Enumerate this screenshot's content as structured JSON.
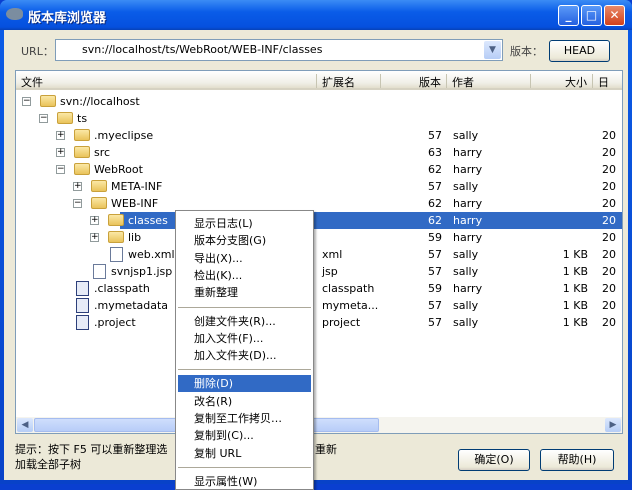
{
  "window": {
    "title": "版本库浏览器"
  },
  "toolbar": {
    "url_label": "URL：",
    "url_value": "svn://localhost/ts/WebRoot/WEB-INF/classes",
    "revision_label": "版本：",
    "revision_button": "HEAD"
  },
  "columns": [
    "文件",
    "扩展名",
    "版本",
    "作者",
    "大小",
    "日"
  ],
  "rows": [
    {
      "name": "svn://localhost",
      "type": "folder",
      "level": 0,
      "expander": "−",
      "ext": "",
      "rev": "",
      "author": "",
      "size": "",
      "date": ""
    },
    {
      "name": "ts",
      "type": "folder",
      "level": 1,
      "expander": "−",
      "ext": "",
      "rev": "",
      "author": "",
      "size": "",
      "date": ""
    },
    {
      "name": ".myeclipse",
      "type": "folder",
      "level": 2,
      "expander": "+",
      "ext": "",
      "rev": "57",
      "author": "sally",
      "size": "",
      "date": "20"
    },
    {
      "name": "src",
      "type": "folder",
      "level": 2,
      "expander": "+",
      "ext": "",
      "rev": "63",
      "author": "harry",
      "size": "",
      "date": "20"
    },
    {
      "name": "WebRoot",
      "type": "folder",
      "level": 2,
      "expander": "−",
      "ext": "",
      "rev": "62",
      "author": "harry",
      "size": "",
      "date": "20"
    },
    {
      "name": "META-INF",
      "type": "folder",
      "level": 3,
      "expander": "+",
      "ext": "",
      "rev": "57",
      "author": "sally",
      "size": "",
      "date": "20"
    },
    {
      "name": "WEB-INF",
      "type": "folder",
      "level": 3,
      "expander": "−",
      "ext": "",
      "rev": "62",
      "author": "harry",
      "size": "",
      "date": "20"
    },
    {
      "name": "classes",
      "type": "folder",
      "level": 4,
      "expander": "+",
      "ext": "",
      "rev": "62",
      "author": "harry",
      "size": "",
      "date": "20",
      "selected": true
    },
    {
      "name": "lib",
      "type": "folder",
      "level": 4,
      "expander": "+",
      "ext": "",
      "rev": "59",
      "author": "harry",
      "size": "",
      "date": "20"
    },
    {
      "name": "web.xml",
      "type": "file",
      "level": 4,
      "expander": "",
      "ext": "xml",
      "rev": "57",
      "author": "sally",
      "size": "1 KB",
      "date": "20"
    },
    {
      "name": "svnjsp1.jsp",
      "type": "file",
      "level": 3,
      "expander": "",
      "ext": "jsp",
      "rev": "57",
      "author": "sally",
      "size": "1 KB",
      "date": "20"
    },
    {
      "name": ".classpath",
      "type": "cfg",
      "level": 2,
      "expander": "",
      "ext": "classpath",
      "rev": "59",
      "author": "harry",
      "size": "1 KB",
      "date": "20"
    },
    {
      "name": ".mymetadata",
      "type": "cfg",
      "level": 2,
      "expander": "",
      "ext": "mymeta...",
      "rev": "57",
      "author": "sally",
      "size": "1 KB",
      "date": "20"
    },
    {
      "name": ".project",
      "type": "cfg",
      "level": 2,
      "expander": "",
      "ext": "project",
      "rev": "57",
      "author": "sally",
      "size": "1 KB",
      "date": "20"
    }
  ],
  "context_menu": {
    "items": [
      {
        "label": "显示日志(L)"
      },
      {
        "label": "版本分支图(G)"
      },
      {
        "label": "导出(X)..."
      },
      {
        "label": "检出(K)..."
      },
      {
        "label": "重新整理"
      },
      {
        "sep": true
      },
      {
        "label": "创建文件夹(R)..."
      },
      {
        "label": "加入文件(F)..."
      },
      {
        "label": "加入文件夹(D)..."
      },
      {
        "sep": true
      },
      {
        "label": "删除(D)",
        "active": true
      },
      {
        "label": "改名(R)"
      },
      {
        "label": "复制至工作拷贝…"
      },
      {
        "label": "复制到(C)..."
      },
      {
        "label": "复制 URL"
      },
      {
        "sep": true
      },
      {
        "label": "显示属性(W)"
      }
    ]
  },
  "footer": {
    "hint_line1_a": "提示：按下 F5 可以重新整理选",
    "hint_line1_b": "重新",
    "hint_line2": "加载全部子树",
    "ok_button": "确定(O)",
    "help_button": "帮助(H)"
  },
  "colors": {
    "selection": "#316ac5",
    "titlebar": "#0a5ce8",
    "dialog_bg": "#ece9d8"
  }
}
